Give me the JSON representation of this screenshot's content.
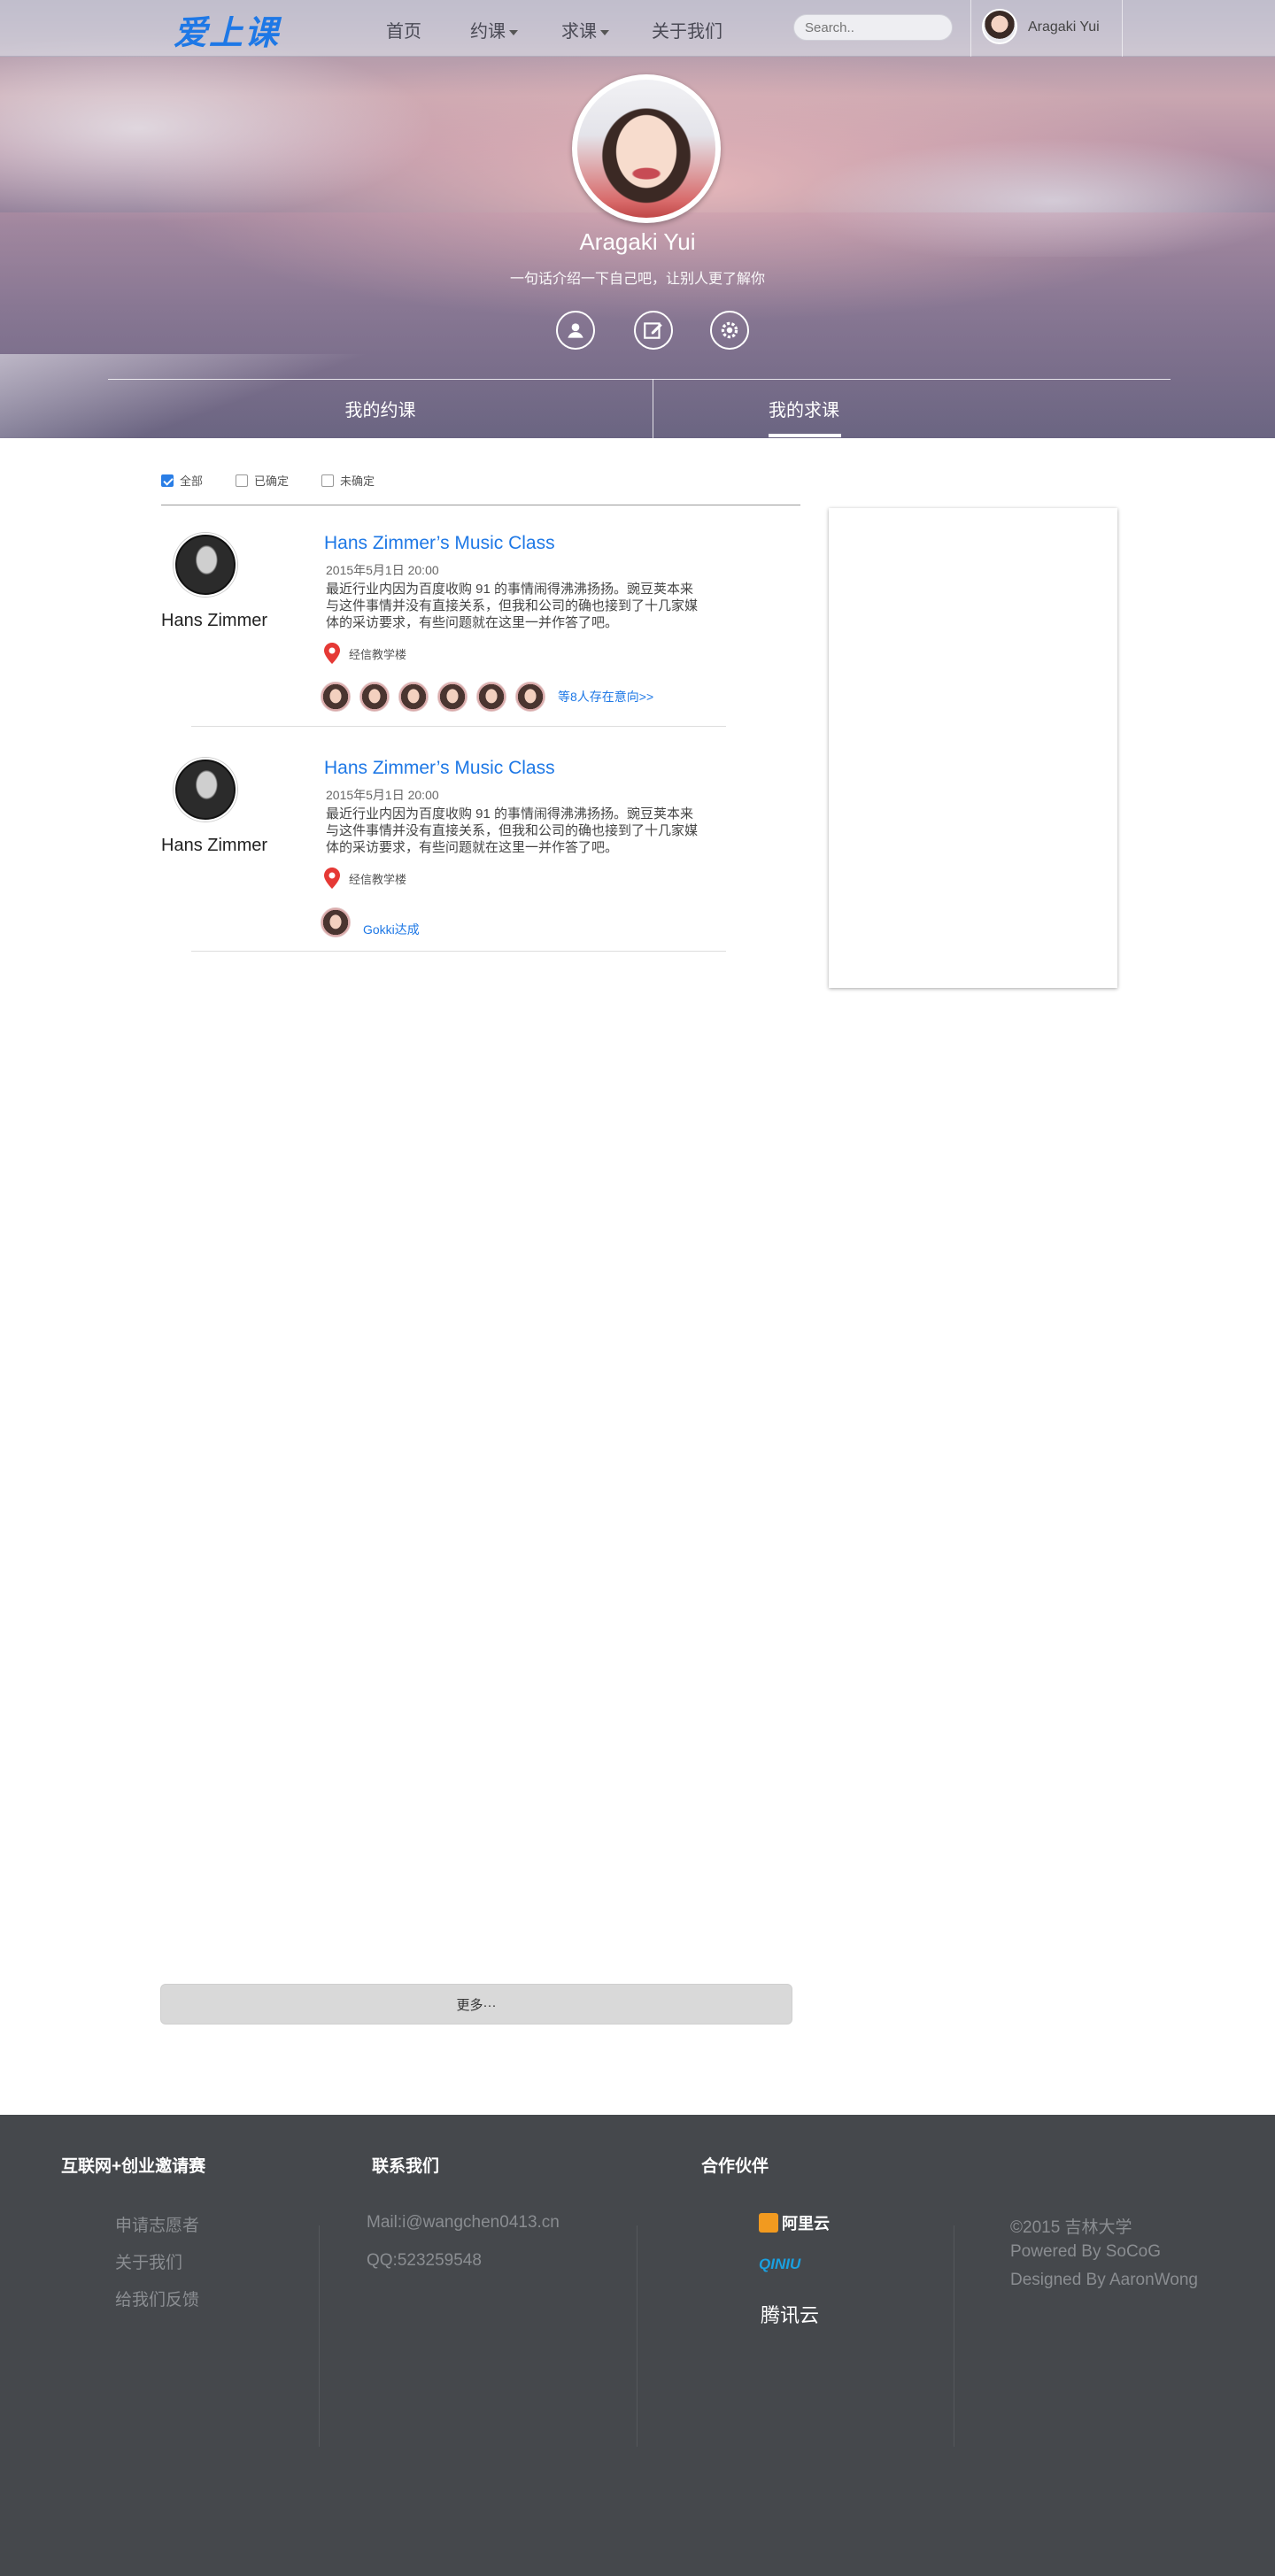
{
  "nav": {
    "logo": "爱上课",
    "links": [
      "首页",
      "约课",
      "求课",
      "关于我们"
    ],
    "search_placeholder": "Search..",
    "user_name": "Aragaki Yui"
  },
  "profile": {
    "name": "Aragaki Yui",
    "bio": "一句话介绍一下自己吧，让别人更了解你",
    "actions": [
      "user-icon",
      "edit-icon",
      "settings-icon"
    ],
    "tabs": [
      "我的约课",
      "我的求课"
    ],
    "active_tab": "我的求课"
  },
  "filters": [
    {
      "label": "全部",
      "checked": true
    },
    {
      "label": "已确定",
      "checked": false
    },
    {
      "label": "未确定",
      "checked": false
    }
  ],
  "courses": [
    {
      "teacher": "Hans Zimmer",
      "title": "Hans Zimmer’s Music Class",
      "date": "2015年5月1日 20:00",
      "desc": "最近行业内因为百度收购 91 的事情闹得沸沸扬扬。豌豆荚本来与这件事情并没有直接关系，但我和公司的确也接到了十几家媒体的采访要求，有些问题就在这里一并作答了吧。",
      "location": "经信教学楼",
      "people_count": 6,
      "people_text": "等8人存在意向>>"
    },
    {
      "teacher": "Hans Zimmer",
      "title": "Hans Zimmer’s Music Class",
      "date": "2015年5月1日 20:00",
      "desc": "最近行业内因为百度收购 91 的事情闹得沸沸扬扬。豌豆荚本来与这件事情并没有直接关系，但我和公司的确也接到了十几家媒体的采访要求，有些问题就在这里一并作答了吧。",
      "location": "经信教学楼",
      "people_count": 1,
      "people_text": "Gokki达成"
    }
  ],
  "more_button": "更多···",
  "footer": {
    "col1": {
      "title": "互联网+创业邀请赛",
      "items": [
        "申请志愿者",
        "关于我们",
        "给我们反馈"
      ]
    },
    "col2": {
      "title": "联系我们",
      "items": [
        "Mail:i@wangchen0413.cn",
        "QQ:523259548"
      ]
    },
    "col3": {
      "title": "合作伙伴",
      "partners": [
        "阿里云",
        "QINIU",
        "腾讯云"
      ]
    },
    "copyright": [
      "©2015 吉林大学",
      "Powered By SoCoG",
      "Designed By AaronWong"
    ]
  },
  "colors": {
    "accent": "#1e78e6",
    "footer_bg": "#45484c",
    "pin": "#e53935"
  }
}
